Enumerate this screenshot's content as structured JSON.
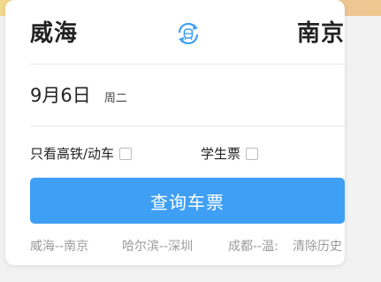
{
  "route": {
    "from_city": "威海",
    "to_city": "南京"
  },
  "swap": {
    "icon": "swap-icon",
    "color": "#3f9ff5"
  },
  "date": {
    "day": "9月6日",
    "weekday": "周二"
  },
  "options": {
    "high_speed_only": "只看高铁/动车",
    "student_ticket": "学生票"
  },
  "search_button": {
    "label": "查询车票",
    "color": "#3f9ff5"
  },
  "history": {
    "items": [
      "威海--南京",
      "哈尔滨--深圳",
      "成都--温:"
    ],
    "clear_label": "清除历史"
  }
}
